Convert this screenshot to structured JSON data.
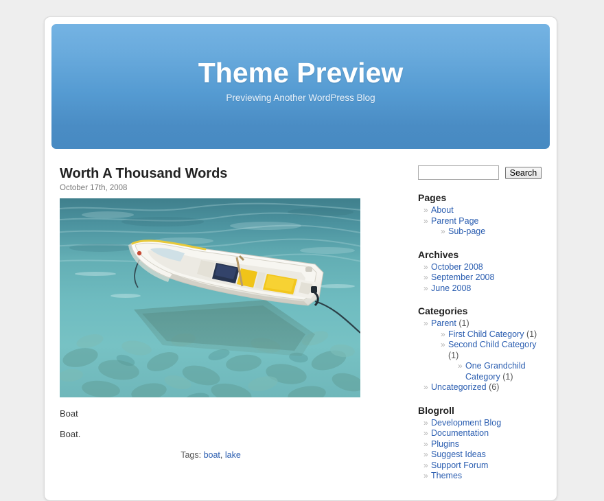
{
  "site": {
    "title": "Theme Preview",
    "description": "Previewing Another WordPress Blog"
  },
  "post": {
    "title": "Worth A Thousand Words",
    "date": "October 17th, 2008",
    "image_alt": "White rowboat floating on clear turquoise water with rocks visible below",
    "paragraph_1": "Boat",
    "paragraph_2": "Boat.",
    "tags_label": "Tags:",
    "tags": [
      {
        "label": "boat"
      },
      {
        "label": "lake"
      }
    ]
  },
  "search": {
    "value": "",
    "placeholder": "",
    "button_label": "Search"
  },
  "sidebar": {
    "pages": {
      "heading": "Pages",
      "items": [
        {
          "label": "About",
          "children": []
        },
        {
          "label": "Parent Page",
          "children": [
            {
              "label": "Sub-page"
            }
          ]
        }
      ]
    },
    "archives": {
      "heading": "Archives",
      "items": [
        {
          "label": "October 2008"
        },
        {
          "label": "September 2008"
        },
        {
          "label": "June 2008"
        }
      ]
    },
    "categories": {
      "heading": "Categories",
      "items": [
        {
          "label": "Parent",
          "count": "(1)",
          "children": [
            {
              "label": "First Child Category",
              "count": "(1)",
              "children": []
            },
            {
              "label": "Second Child Category",
              "count": "(1)",
              "children": [
                {
                  "label": "One Grandchild Category",
                  "count": "(1)",
                  "children": []
                }
              ]
            }
          ]
        },
        {
          "label": "Uncategorized",
          "count": "(6)",
          "children": []
        }
      ]
    },
    "blogroll": {
      "heading": "Blogroll",
      "items": [
        {
          "label": "Development Blog"
        },
        {
          "label": "Documentation"
        },
        {
          "label": "Plugins"
        },
        {
          "label": "Suggest Ideas"
        },
        {
          "label": "Support Forum"
        },
        {
          "label": "Themes"
        }
      ]
    }
  },
  "colors": {
    "page_background": "#eeeeee",
    "header_gradient_top": "#74b3e3",
    "header_gradient_bottom": "#478ac2",
    "link": "#2a5db0",
    "heading": "#222222",
    "muted_text": "#777777"
  }
}
